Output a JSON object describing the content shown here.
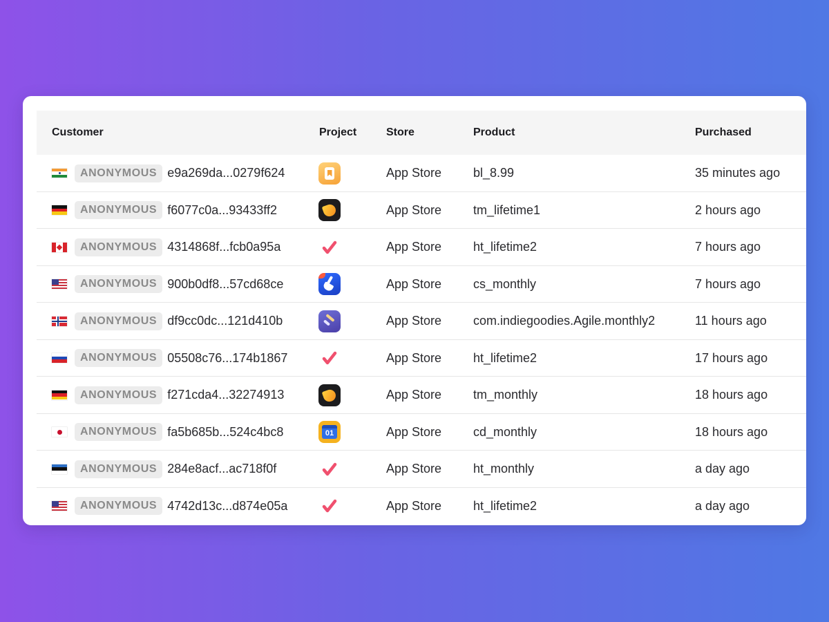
{
  "table": {
    "columns": {
      "customer": "Customer",
      "project": "Project",
      "store": "Store",
      "product": "Product",
      "purchased": "Purchased"
    },
    "rows": [
      {
        "country": "india",
        "badge": "ANONYMOUS",
        "customer_id": "e9a269da...0279f624",
        "project_icon": "bookmark-app-icon",
        "store": "App Store",
        "product": "bl_8.99",
        "purchased": "35 minutes ago"
      },
      {
        "country": "germany",
        "badge": "ANONYMOUS",
        "customer_id": "f6077c0a...93433ff2",
        "project_icon": "flame-app-icon",
        "store": "App Store",
        "product": "tm_lifetime1",
        "purchased": "2 hours ago"
      },
      {
        "country": "canada",
        "badge": "ANONYMOUS",
        "customer_id": "4314868f...fcb0a95a",
        "project_icon": "checkmark-app-icon",
        "store": "App Store",
        "product": "ht_lifetime2",
        "purchased": "7 hours ago"
      },
      {
        "country": "usa",
        "badge": "ANONYMOUS",
        "customer_id": "900b0df8...57cd68ce",
        "project_icon": "broom-app-icon",
        "store": "App Store",
        "product": "cs_monthly",
        "purchased": "7 hours ago"
      },
      {
        "country": "norway",
        "badge": "ANONYMOUS",
        "customer_id": "df9cc0dc...121d410b",
        "project_icon": "agile-app-icon",
        "store": "App Store",
        "product": "com.indiegoodies.Agile.monthly2",
        "purchased": "11 hours ago"
      },
      {
        "country": "russia",
        "badge": "ANONYMOUS",
        "customer_id": "05508c76...174b1867",
        "project_icon": "checkmark-app-icon",
        "store": "App Store",
        "product": "ht_lifetime2",
        "purchased": "17 hours ago"
      },
      {
        "country": "germany",
        "badge": "ANONYMOUS",
        "customer_id": "f271cda4...32274913",
        "project_icon": "flame-app-icon",
        "store": "App Store",
        "product": "tm_monthly",
        "purchased": "18 hours ago"
      },
      {
        "country": "japan",
        "badge": "ANONYMOUS",
        "customer_id": "fa5b685b...524c4bc8",
        "project_icon": "calendar-app-icon",
        "calendar_label": "01",
        "store": "App Store",
        "product": "cd_monthly",
        "purchased": "18 hours ago"
      },
      {
        "country": "estonia",
        "badge": "ANONYMOUS",
        "customer_id": "284e8acf...ac718f0f",
        "project_icon": "checkmark-app-icon",
        "store": "App Store",
        "product": "ht_monthly",
        "purchased": "a day ago"
      },
      {
        "country": "usa",
        "badge": "ANONYMOUS",
        "customer_id": "4742d13c...d874e05a",
        "project_icon": "checkmark-app-icon",
        "store": "App Store",
        "product": "ht_lifetime2",
        "purchased": "a day ago"
      }
    ]
  },
  "colors": {
    "background_start": "#8e52e8",
    "background_end": "#4f78e4",
    "header_bg": "#f5f5f5",
    "badge_bg": "#ececec",
    "badge_text": "#8a8a8a",
    "checkmark": "#f0506e"
  }
}
